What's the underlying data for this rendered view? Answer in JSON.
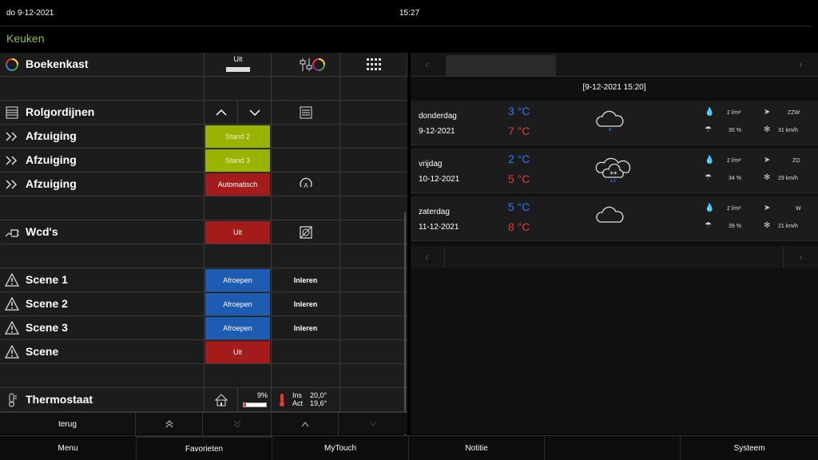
{
  "topbar": {
    "date": "do  9-12-2021",
    "clock": "15:27"
  },
  "room": "Keuken",
  "rows": [
    {
      "label": "Boekenkast",
      "icon": "color-wheel-icon",
      "state": "Uit"
    },
    {
      "label": "Rolgordijnen",
      "icon": "blinds-icon"
    },
    {
      "label": "Afzuiging",
      "icon": "fan-icon",
      "action": "Stand 2",
      "color": "green"
    },
    {
      "label": "Afzuiging",
      "icon": "fan-icon",
      "action": "Stand 3",
      "color": "green"
    },
    {
      "label": "Afzuiging",
      "icon": "fan-icon",
      "action": "Automatisch",
      "color": "red"
    },
    {
      "label": "Wcd's",
      "icon": "socket-icon",
      "action": "Uit",
      "color": "red"
    },
    {
      "label": "Scene 1",
      "icon": "warning-icon",
      "action": "Afroepen",
      "action2": "Inleren",
      "color": "blue"
    },
    {
      "label": "Scene 2",
      "icon": "warning-icon",
      "action": "Afroepen",
      "action2": "Inleren",
      "color": "blue"
    },
    {
      "label": "Scene 3",
      "icon": "warning-icon",
      "action": "Afroepen",
      "action2": "Inleren",
      "color": "blue"
    },
    {
      "label": "Scene",
      "icon": "warning-icon",
      "action": "Uit",
      "color": "red"
    },
    {
      "label": "Thermostaat",
      "icon": "thermometer-icon",
      "percent": "9%",
      "ins_label": "Ins",
      "ins_value": "20,0°",
      "act_label": "Act",
      "act_value": "19,6°"
    }
  ],
  "bottomnav": {
    "back": "terug"
  },
  "menubar": [
    "Menu",
    "Favorieten",
    "MyTouch",
    "Notitie",
    "",
    "Systeem"
  ],
  "weather": {
    "timestamp": "[9-12-2021 15:20]",
    "days": [
      {
        "day": "donderdag",
        "date": "9-12-2021",
        "low": "3 °C",
        "high": "7 °C",
        "rain": "2 l/m²",
        "chance": "30 %",
        "wind_dir": "ZZW",
        "wind_speed": "31 km/h",
        "symbol": "cloud-rain-icon"
      },
      {
        "day": "vrijdag",
        "date": "10-12-2021",
        "low": "2 °C",
        "high": "5 °C",
        "rain": "2 l/m²",
        "chance": "34 %",
        "wind_dir": "ZO",
        "wind_speed": "29 km/h",
        "symbol": "cloud-snow-icon"
      },
      {
        "day": "zaterdag",
        "date": "11-12-2021",
        "low": "5 °C",
        "high": "8 °C",
        "rain": "2 l/m²",
        "chance": "39 %",
        "wind_dir": "W",
        "wind_speed": "21 km/h",
        "symbol": "cloud-icon"
      }
    ]
  },
  "colors": {
    "room": "#8bc34a",
    "green": "#9ab200",
    "red": "#a31b1b",
    "blue": "#1e5bb3",
    "low": "#2979ff",
    "high": "#e53935"
  }
}
